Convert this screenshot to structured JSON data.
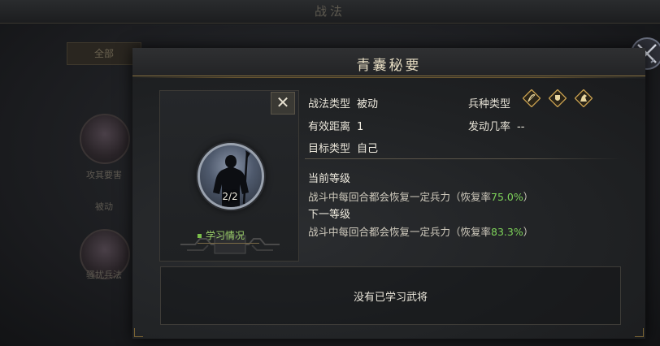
{
  "background": {
    "title": "战法",
    "tab_label": "全部",
    "skills": [
      {
        "label": "攻其要害"
      },
      {
        "label": "被动"
      },
      {
        "label": "骚扰兵法"
      }
    ]
  },
  "modal": {
    "title": "青囊秘要",
    "close_icon": "close-icon",
    "portrait": {
      "level": "2/2",
      "learn_status_label": "学习情况"
    },
    "info": {
      "tactic_type_key": "战法类型",
      "tactic_type_val": "被动",
      "range_key": "有效距离",
      "range_val": "1",
      "target_key": "目标类型",
      "target_val": "自己",
      "troop_type_key": "兵种类型",
      "troop_icons": [
        "bow-troop-icon",
        "shield-troop-icon",
        "cavalry-troop-icon"
      ],
      "trigger_rate_key": "发动几率",
      "trigger_rate_val": "--"
    },
    "current_level": {
      "title": "当前等级",
      "desc_prefix": "战斗中每回合都会恢复一定兵力（恢复率",
      "desc_value": "75.0%",
      "desc_suffix": "）"
    },
    "next_level": {
      "title": "下一等级",
      "desc_prefix": "战斗中每回合都会恢复一定兵力（恢复率",
      "desc_value": "83.3%",
      "desc_suffix": "）"
    },
    "learned_box_text": "没有已学习武将"
  },
  "colors": {
    "accent_gold": "#8a7340",
    "highlight_green": "#7ed35a"
  }
}
